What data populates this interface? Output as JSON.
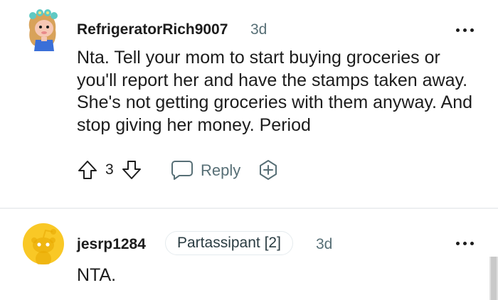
{
  "comments": [
    {
      "username": "RefrigeratorRich9007",
      "time": "3d",
      "text": "Nta. Tell your mom to start buying groceries or you'll report her and have the stamps taken away. She's not getting groceries with them anyway. And stop giving her money. Period",
      "score": "3",
      "reply_label": "Reply",
      "avatar_icon": "snoo-avatar-icon"
    },
    {
      "username": "jesrp1284",
      "flair": "Partassipant [2]",
      "time": "3d",
      "text": "NTA.",
      "avatar_icon": "default-snoo-avatar-icon"
    }
  ],
  "colors": {
    "text": "#1c1c1c",
    "muted": "#576f76",
    "divider": "#edeff1",
    "avatar_yellow": "#f9c826"
  }
}
